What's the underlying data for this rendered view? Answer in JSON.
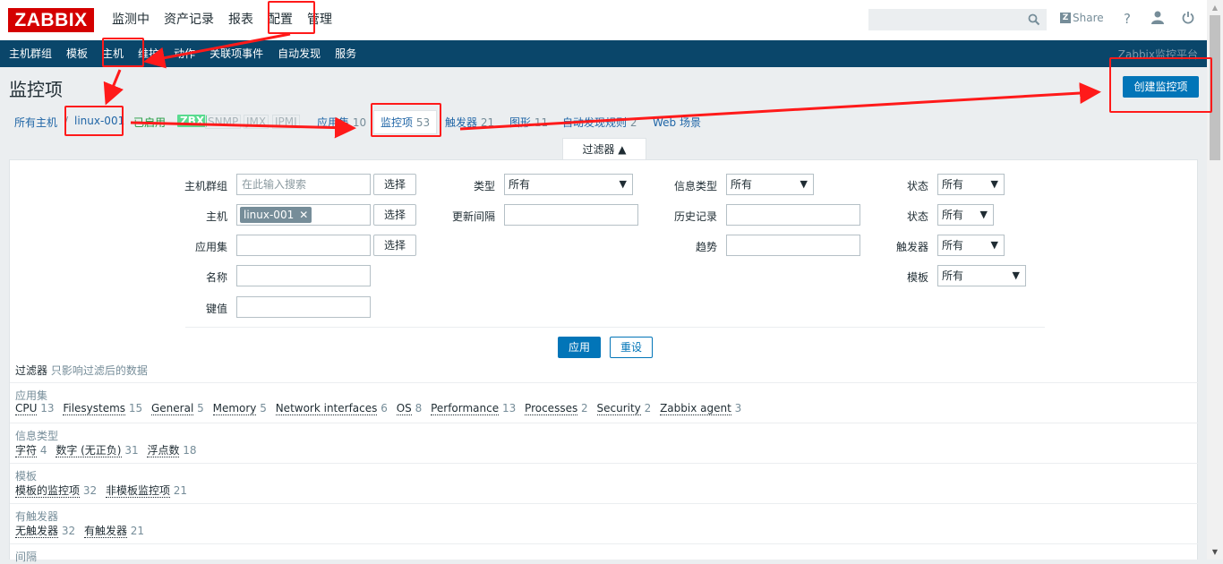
{
  "logo": "ZABBIX",
  "top_nav": [
    "监测中",
    "资产记录",
    "报表",
    "配置",
    "管理"
  ],
  "header": {
    "share": "Share",
    "help_icon": "?"
  },
  "sub_nav": [
    "主机群组",
    "模板",
    "主机",
    "维护",
    "动作",
    "关联项事件",
    "自动发现",
    "服务"
  ],
  "brand": "Zabbix监控平台",
  "page": {
    "title": "监控项",
    "create_button": "创建监控项"
  },
  "crumbs": {
    "all_hosts": "所有主机",
    "sep": "/",
    "host": "linux-001",
    "enabled": "已启用",
    "zbx": "ZBX",
    "snmp": "SNMP",
    "jmx": "JMX",
    "ipmi": "IPMI",
    "apps": {
      "label": "应用集",
      "count": "10"
    },
    "items": {
      "label": "监控项",
      "count": "53"
    },
    "triggers": {
      "label": "触发器",
      "count": "21"
    },
    "graphs": {
      "label": "图形",
      "count": "11"
    },
    "discovery": {
      "label": "自动发现规则",
      "count": "2"
    },
    "web": "Web 场景"
  },
  "filter": {
    "tab": "过滤器 ▲",
    "labels": {
      "host_group": "主机群组",
      "host": "主机",
      "app": "应用集",
      "name": "名称",
      "key": "键值",
      "type": "类型",
      "update_interval": "更新间隔",
      "info_type": "信息类型",
      "history": "历史记录",
      "trends": "趋势",
      "status1": "状态",
      "status2": "状态",
      "triggers": "触发器",
      "template": "模板"
    },
    "host_group_placeholder": "在此输入搜索",
    "select_button": "选择",
    "host_chip": "linux-001",
    "chip_remove": "✕",
    "type_value": "所有",
    "info_type_value": "所有",
    "status1_value": "所有",
    "status2_value": "所有",
    "triggers_value": "所有",
    "template_value": "所有",
    "apply": "应用",
    "reset": "重设"
  },
  "subfilter": {
    "title": "过滤器",
    "hint": "只影响过滤后的数据",
    "groups": [
      {
        "title": "应用集",
        "items": [
          {
            "label": "CPU",
            "count": "13"
          },
          {
            "label": "Filesystems",
            "count": "15"
          },
          {
            "label": "General",
            "count": "5"
          },
          {
            "label": "Memory",
            "count": "5"
          },
          {
            "label": "Network interfaces",
            "count": "6"
          },
          {
            "label": "OS",
            "count": "8"
          },
          {
            "label": "Performance",
            "count": "13"
          },
          {
            "label": "Processes",
            "count": "2"
          },
          {
            "label": "Security",
            "count": "2"
          },
          {
            "label": "Zabbix agent",
            "count": "3"
          }
        ]
      },
      {
        "title": "信息类型",
        "items": [
          {
            "label": "字符",
            "count": "4"
          },
          {
            "label": "数字 (无正负)",
            "count": "31"
          },
          {
            "label": "浮点数",
            "count": "18"
          }
        ]
      },
      {
        "title": "模板",
        "items": [
          {
            "label": "模板的监控项",
            "count": "32"
          },
          {
            "label": "非模板监控项",
            "count": "21"
          }
        ]
      },
      {
        "title": "有触发器",
        "items": [
          {
            "label": "无触发器",
            "count": "32"
          },
          {
            "label": "有触发器",
            "count": "21"
          }
        ]
      },
      {
        "title": "间隔",
        "items": []
      }
    ]
  },
  "colors": {
    "nav": "#0a466a",
    "primary": "#0275b8",
    "annotation": "#ff1a1a",
    "logo": "#d40000"
  }
}
